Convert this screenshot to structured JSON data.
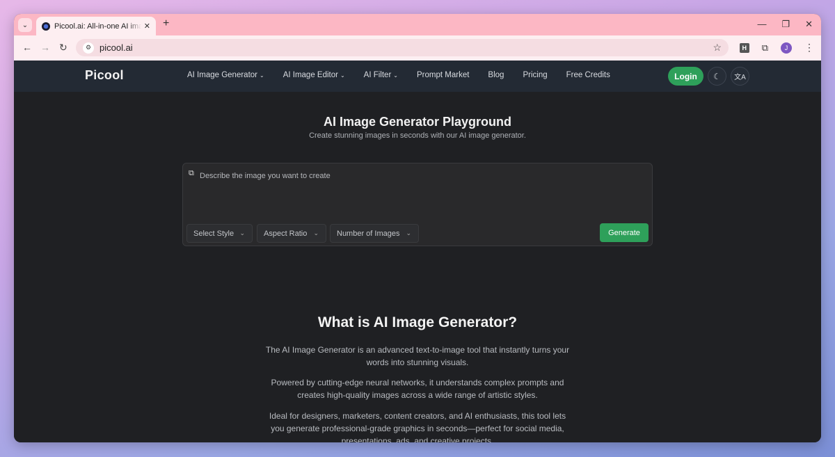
{
  "browser": {
    "tab_title": "Picool.ai: All-in-one AI image generator",
    "url": "picool.ai",
    "profile_initial": "J",
    "extension_label": "H"
  },
  "header": {
    "logo": "Picool",
    "nav": [
      {
        "label": "AI Image Generator",
        "dropdown": true
      },
      {
        "label": "AI Image Editor",
        "dropdown": true
      },
      {
        "label": "AI Filter",
        "dropdown": true
      },
      {
        "label": "Prompt Market",
        "dropdown": false
      },
      {
        "label": "Blog",
        "dropdown": false
      },
      {
        "label": "Pricing",
        "dropdown": false
      },
      {
        "label": "Free Credits",
        "dropdown": false
      }
    ],
    "login_label": "Login"
  },
  "hero": {
    "title": "AI Image Generator Playground",
    "subtitle": "Create stunning images in seconds with our AI image generator."
  },
  "prompt": {
    "placeholder": "Describe the image you want to create",
    "style_select": "Select Style",
    "aspect_select": "Aspect Ratio",
    "count_select": "Number of Images",
    "generate_label": "Generate"
  },
  "about": {
    "title": "What is AI Image Generator?",
    "paragraphs": [
      "The AI Image Generator is an advanced text-to-image tool that instantly turns your words into stunning visuals.",
      "Powered by cutting-edge neural networks, it understands complex prompts and creates high-quality images across a wide range of artistic styles.",
      "Ideal for designers, marketers, content creators, and AI enthusiasts, this tool lets you generate professional-grade graphics in seconds—perfect for social media, presentations, ads, and creative projects."
    ]
  },
  "colors": {
    "accent_green": "#2ea05a",
    "header_bg": "#232a34",
    "page_bg": "#1f2023",
    "tabbar_bg": "#fcb7c4"
  }
}
